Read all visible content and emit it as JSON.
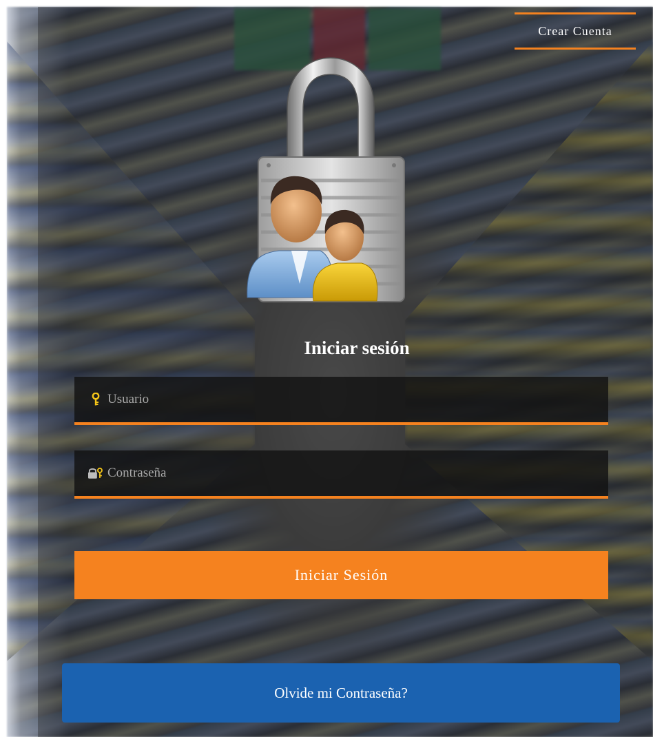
{
  "header": {
    "create_account_label": "Crear Cuenta"
  },
  "hero": {
    "icon": "padlock-users-icon"
  },
  "login": {
    "title": "Iniciar sesión",
    "username": {
      "placeholder": "Usuario",
      "value": "",
      "icon": "key-icon"
    },
    "password": {
      "placeholder": "Contraseña",
      "value": "",
      "icon": "lock-key-icon"
    },
    "submit_label": "Iniciar Sesión",
    "forgot_label": "Olvide mi Contraseña?"
  },
  "colors": {
    "accent": "#f5821f",
    "secondary": "#1b62b0",
    "field_bg": "#121212"
  }
}
